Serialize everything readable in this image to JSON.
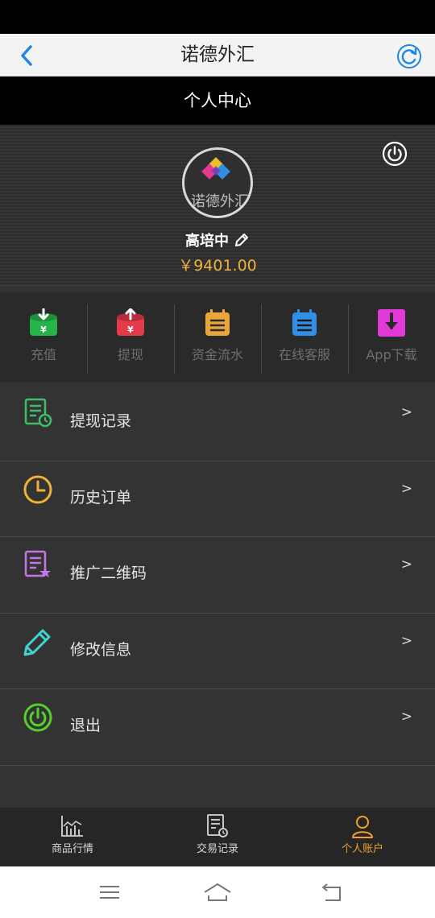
{
  "app": {
    "title": "诺德外汇"
  },
  "subheader": {
    "title": "个人中心"
  },
  "profile": {
    "avatar_text": "诺德外汇",
    "username": "高培中",
    "balance": "￥9401.00"
  },
  "quick_actions": [
    {
      "label": "充值",
      "icon": "deposit-icon",
      "color": "#27b24a"
    },
    {
      "label": "提现",
      "icon": "withdraw-icon",
      "color": "#e43b4b"
    },
    {
      "label": "资金流水",
      "icon": "ledger-icon",
      "color": "#e9a63a"
    },
    {
      "label": "在线客服",
      "icon": "support-icon",
      "color": "#2f8fe6"
    },
    {
      "label": "App下载",
      "icon": "download-icon",
      "color": "#e23ad9"
    }
  ],
  "menu": [
    {
      "label": "提现记录",
      "icon": "withdraw-record-icon",
      "color": "#3ebd6a",
      "arrow": ">"
    },
    {
      "label": "历史订单",
      "icon": "clock-icon",
      "color": "#f0b33a",
      "arrow": ">"
    },
    {
      "label": "推广二维码",
      "icon": "qrcode-doc-icon",
      "color": "#c575e6",
      "arrow": ">"
    },
    {
      "label": "修改信息",
      "icon": "pencil-icon",
      "color": "#3fd4d0",
      "arrow": ">"
    },
    {
      "label": "退出",
      "icon": "power-icon",
      "color": "#53d22c",
      "arrow": ">"
    }
  ],
  "tabs": [
    {
      "label": "商品行情",
      "icon": "chart-icon",
      "active": false
    },
    {
      "label": "交易记录",
      "icon": "record-icon",
      "active": false
    },
    {
      "label": "个人账户",
      "icon": "user-icon",
      "active": true
    }
  ],
  "colors": {
    "accent": "#f0a22a",
    "balance": "#f0b33a",
    "back_arrow": "#1e88e5"
  }
}
